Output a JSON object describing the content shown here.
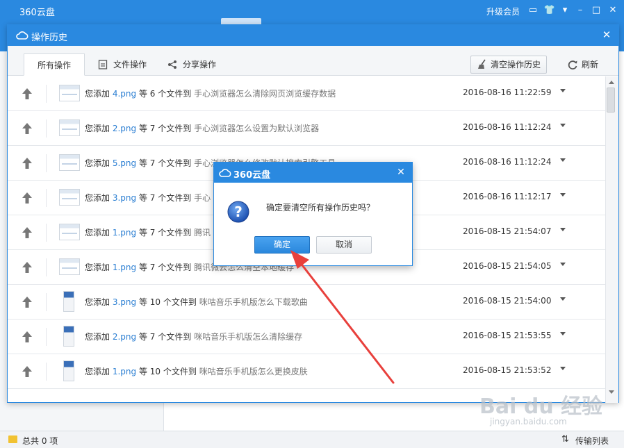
{
  "app": {
    "title": "360云盘",
    "upgrade": "升级会员",
    "icons": [
      "message-icon",
      "shirt-icon",
      "menu-icon",
      "minimize-icon",
      "maximize-icon",
      "close-icon"
    ]
  },
  "status": {
    "total": "总共 0 项",
    "transfer": "传输列表"
  },
  "history": {
    "title": "操作历史",
    "tabs": [
      "所有操作",
      "文件操作",
      "分享操作"
    ],
    "clear_label": "清空操作历史",
    "refresh_label": "刷新",
    "rows": [
      {
        "prefix": "您添加",
        "file": "4.png",
        "count": "等 6 个文件到",
        "dest": "手心浏览器怎么清除网页浏览缓存数据",
        "time": "2016-08-16 11:22:59",
        "thumb": "wide"
      },
      {
        "prefix": "您添加",
        "file": "2.png",
        "count": "等 7 个文件到",
        "dest": "手心浏览器怎么设置为默认浏览器",
        "time": "2016-08-16 11:12:24",
        "thumb": "wide"
      },
      {
        "prefix": "您添加",
        "file": "5.png",
        "count": "等 7 个文件到",
        "dest": "手心浏览器怎么修改默认搜索引擎工具",
        "time": "2016-08-16 11:12:24",
        "thumb": "wide"
      },
      {
        "prefix": "您添加",
        "file": "3.png",
        "count": "等 7 个文件到",
        "dest": "手心",
        "time": "2016-08-16 11:12:17",
        "thumb": "wide"
      },
      {
        "prefix": "您添加",
        "file": "1.png",
        "count": "等 7 个文件到",
        "dest": "腾讯",
        "time": "2016-08-15 21:54:07",
        "thumb": "wide"
      },
      {
        "prefix": "您添加",
        "file": "1.png",
        "count": "等 7 个文件到",
        "dest": "腾讯微云怎么清空本地缓存",
        "time": "2016-08-15 21:54:05",
        "thumb": "wide"
      },
      {
        "prefix": "您添加",
        "file": "3.png",
        "count": "等 10 个文件到",
        "dest": "咪咕音乐手机版怎么下载歌曲",
        "time": "2016-08-15 21:54:00",
        "thumb": "phone"
      },
      {
        "prefix": "您添加",
        "file": "2.png",
        "count": "等 7 个文件到",
        "dest": "咪咕音乐手机版怎么清除缓存",
        "time": "2016-08-15 21:53:55",
        "thumb": "phone"
      },
      {
        "prefix": "您添加",
        "file": "1.png",
        "count": "等 10 个文件到",
        "dest": "咪咕音乐手机版怎么更换皮肤",
        "time": "2016-08-15 21:53:52",
        "thumb": "phone"
      }
    ]
  },
  "dialog": {
    "title": "360云盘",
    "message": "确定要清空所有操作历史吗？",
    "ok": "确定",
    "cancel": "取消"
  },
  "watermark": {
    "brand": "Bai du 经验",
    "url": "jingyan.baidu.com"
  },
  "colors": {
    "accent": "#2a89e0",
    "link": "#2a7ed2",
    "annotation_arrow": "#e8403c"
  }
}
